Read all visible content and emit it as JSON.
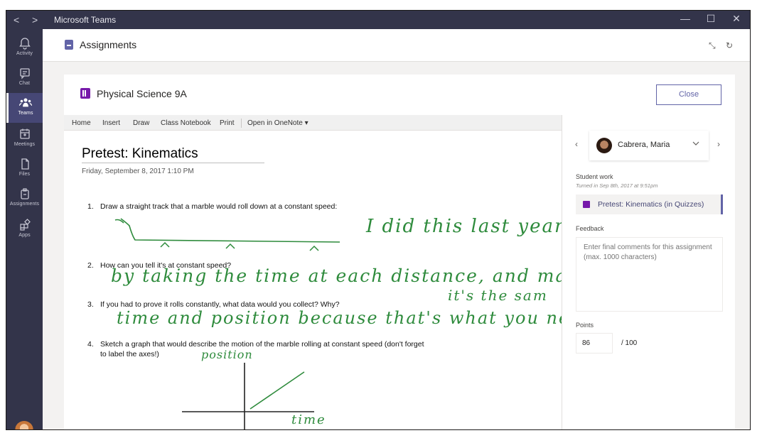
{
  "titlebar": {
    "back": "<",
    "forward": ">",
    "title": "Microsoft Teams",
    "minimize": "—",
    "maximize": "☐",
    "close": "✕"
  },
  "rail": {
    "items": [
      {
        "label": "Activity",
        "icon": "bell-icon"
      },
      {
        "label": "Chat",
        "icon": "chat-icon"
      },
      {
        "label": "Teams",
        "icon": "teams-icon"
      },
      {
        "label": "Meetings",
        "icon": "calendar-icon"
      },
      {
        "label": "Files",
        "icon": "file-icon"
      },
      {
        "label": "Assignments",
        "icon": "assignments-icon"
      },
      {
        "label": "Apps",
        "icon": "apps-icon"
      }
    ],
    "active": "Teams"
  },
  "header": {
    "title": "Assignments",
    "collapse": "⤡",
    "refresh": "↻"
  },
  "card": {
    "class_name": "Physical Science 9A",
    "close_label": "Close"
  },
  "toolbar": {
    "items": [
      "Home",
      "Insert",
      "Draw",
      "Class Notebook",
      "Print",
      "Open in OneNote ▾"
    ]
  },
  "page": {
    "title": "Pretest: Kinematics",
    "date": "Friday, September 8, 2017  1:10 PM",
    "questions": [
      {
        "num": "1.",
        "text": "Draw a straight track that a marble would roll down at a constant speed:"
      },
      {
        "num": "2.",
        "text": "How can you tell it's at constant speed?"
      },
      {
        "num": "3.",
        "text": "If you had to prove it rolls constantly, what data would you collect? Why?"
      },
      {
        "num": "4.",
        "text": "Sketch a graph that would describe the motion of the marble rolling at constant speed (don't forget",
        "text2": "to label the axes!)"
      }
    ],
    "ink": {
      "note1": "I did this last year .",
      "answer2": "by taking the time at each distance, and maki",
      "answer2b": "it's the sam",
      "answer3": "time and position because that's what you ne",
      "graph_y": "position",
      "graph_x": "time"
    }
  },
  "side": {
    "student": "Cabrera, Maria",
    "prev": "‹",
    "next": "›",
    "student_work_label": "Student work",
    "turned_in": "Turned in Sep 8th, 2017 at 9:51pm",
    "work_item": "Pretest: Kinematics (in Quizzes)",
    "feedback_label": "Feedback",
    "feedback_placeholder": "Enter final comments for this assignment (max. 1000 characters)",
    "points_label": "Points",
    "points_value": "86",
    "points_total": "/ 100"
  },
  "colors": {
    "rail": "#33344a",
    "accent": "#6264a7",
    "ink": "#2e8b3c",
    "onenote": "#7719aa"
  }
}
